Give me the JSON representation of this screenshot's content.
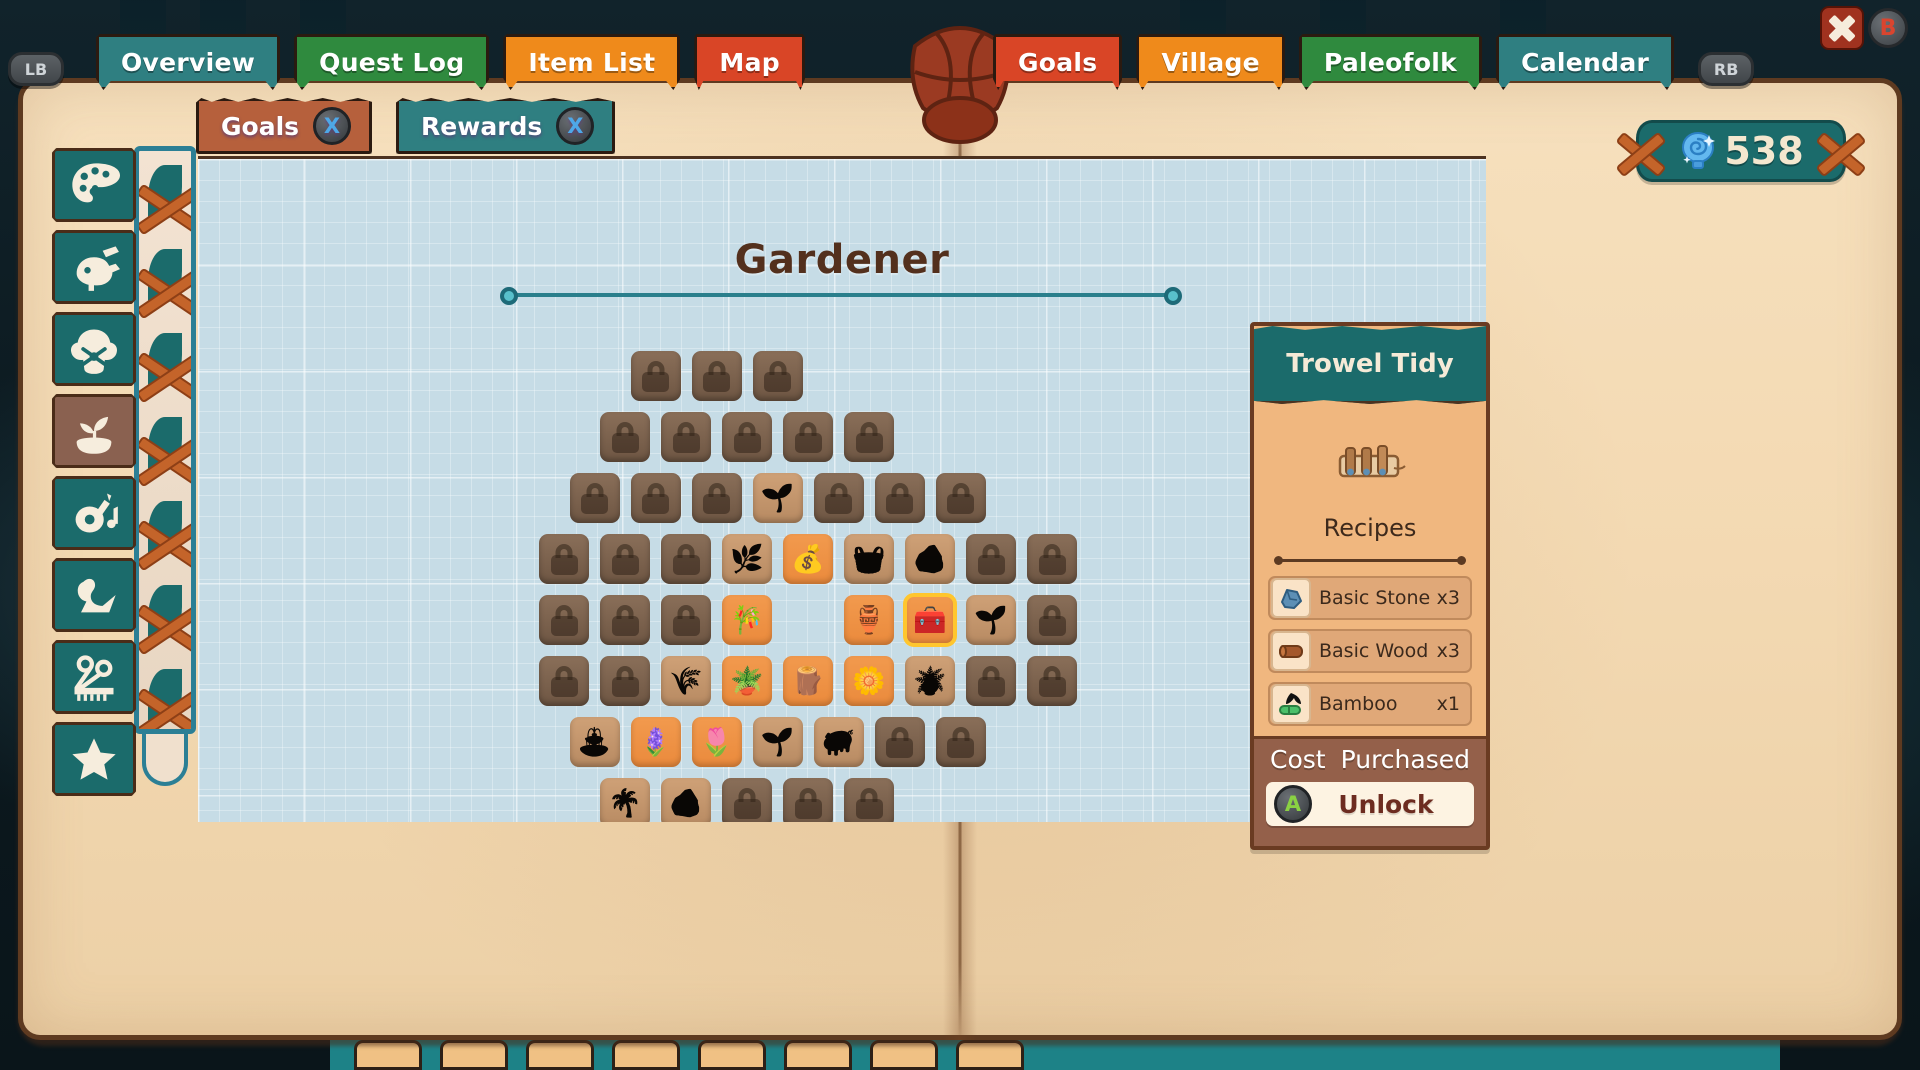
{
  "window": {
    "close_button": {
      "name": "close-button",
      "glyph": "X"
    },
    "close_hint": "B"
  },
  "top_tabs": {
    "left_bumper": "LB",
    "right_bumper": "RB",
    "items": [
      {
        "label": "Overview",
        "color": "#2f7f81",
        "active": false
      },
      {
        "label": "Quest Log",
        "color": "#2f8a3e",
        "active": false
      },
      {
        "label": "Item List",
        "color": "#ef8a1b",
        "active": false
      },
      {
        "label": "Map",
        "color": "#d94526",
        "active": false
      },
      {
        "label": "Goals",
        "color": "#d94526",
        "active": true
      },
      {
        "label": "Village",
        "color": "#ef8a1b",
        "active": false
      },
      {
        "label": "Paleofolk",
        "color": "#2f8a3e",
        "active": false
      },
      {
        "label": "Calendar",
        "color": "#2f7f81",
        "active": false
      }
    ]
  },
  "sub_tabs": [
    {
      "label": "Goals",
      "button": "X",
      "color": "#b6603c",
      "active": false
    },
    {
      "label": "Rewards",
      "button": "X",
      "color": "#2f7f81",
      "active": true
    }
  ],
  "currency": {
    "amount": "538",
    "icon": "shell-icon"
  },
  "sidebar": {
    "items": [
      {
        "name": "sidebar-item-art",
        "icon": "palette-icon",
        "active": false
      },
      {
        "name": "sidebar-item-fossils",
        "icon": "fossil-icon",
        "active": false
      },
      {
        "name": "sidebar-item-cooking",
        "icon": "cooking-icon",
        "active": false
      },
      {
        "name": "sidebar-item-gardener",
        "icon": "potted-plant-icon",
        "active": true
      },
      {
        "name": "sidebar-item-music",
        "icon": "guitar-icon",
        "active": false
      },
      {
        "name": "sidebar-item-origami",
        "icon": "origami-swan-icon",
        "active": false
      },
      {
        "name": "sidebar-item-barber",
        "icon": "scissors-comb-icon",
        "active": false
      },
      {
        "name": "sidebar-item-favorites",
        "icon": "star-icon",
        "active": false
      }
    ]
  },
  "page": {
    "title": "Gardener",
    "progress": {
      "start_node": true,
      "end_node": true
    }
  },
  "grid": {
    "rows": [
      {
        "offset": 5,
        "cells": [
          {
            "state": "locked",
            "icon": "lock-icon"
          },
          {
            "state": "locked",
            "icon": "lock-icon"
          },
          {
            "state": "locked",
            "icon": "lock-icon"
          }
        ]
      },
      {
        "offset": 4,
        "cells": [
          {
            "state": "locked",
            "icon": "lock-icon"
          },
          {
            "state": "locked",
            "icon": "lock-icon"
          },
          {
            "state": "locked",
            "icon": "lock-icon"
          },
          {
            "state": "locked",
            "icon": "lock-icon"
          },
          {
            "state": "locked",
            "icon": "lock-icon"
          }
        ]
      },
      {
        "offset": 3,
        "cells": [
          {
            "state": "locked",
            "icon": "lock-icon"
          },
          {
            "state": "locked",
            "icon": "lock-icon"
          },
          {
            "state": "locked",
            "icon": "lock-icon"
          },
          {
            "state": "unlocked",
            "icon": "sprout-bowl-icon",
            "glyph": "🌱"
          },
          {
            "state": "locked",
            "icon": "lock-icon"
          },
          {
            "state": "locked",
            "icon": "lock-icon"
          },
          {
            "state": "locked",
            "icon": "lock-icon"
          }
        ]
      },
      {
        "offset": 2,
        "cells": [
          {
            "state": "locked",
            "icon": "lock-icon"
          },
          {
            "state": "locked",
            "icon": "lock-icon"
          },
          {
            "state": "locked",
            "icon": "lock-icon"
          },
          {
            "state": "unlocked",
            "icon": "bush-icon",
            "glyph": "🌿"
          },
          {
            "state": "owned",
            "icon": "seed-bag-icon",
            "glyph": "💰"
          },
          {
            "state": "unlocked",
            "icon": "basket-icon",
            "glyph": "🧺"
          },
          {
            "state": "unlocked",
            "icon": "rock-garden-icon",
            "glyph": "🪨"
          },
          {
            "state": "locked",
            "icon": "lock-icon"
          },
          {
            "state": "locked",
            "icon": "lock-icon"
          }
        ]
      },
      {
        "offset": 2,
        "cells": [
          {
            "state": "locked",
            "icon": "lock-icon"
          },
          {
            "state": "locked",
            "icon": "lock-icon"
          },
          {
            "state": "locked",
            "icon": "lock-icon"
          },
          {
            "state": "owned",
            "icon": "rake-icon",
            "glyph": "🎋"
          },
          {
            "state": "empty",
            "icon": ""
          },
          {
            "state": "owned",
            "icon": "vase-icon",
            "glyph": "🏺"
          },
          {
            "state": "owned",
            "icon": "trowel-tidy-icon",
            "glyph": "🧰",
            "selected": true
          },
          {
            "state": "unlocked",
            "icon": "potted-sprout-icon",
            "glyph": "🌱"
          },
          {
            "state": "locked",
            "icon": "lock-icon"
          }
        ]
      },
      {
        "offset": 2,
        "cells": [
          {
            "state": "locked",
            "icon": "lock-icon"
          },
          {
            "state": "locked",
            "icon": "lock-icon"
          },
          {
            "state": "unlocked",
            "icon": "shrub-icon",
            "glyph": "🌾"
          },
          {
            "state": "owned",
            "icon": "planter-box-icon",
            "glyph": "🪴"
          },
          {
            "state": "owned",
            "icon": "log-icon",
            "glyph": "🪵"
          },
          {
            "state": "owned",
            "icon": "flower-trough-icon",
            "glyph": "🌼"
          },
          {
            "state": "unlocked",
            "icon": "palm-pot-icon",
            "glyph": "🪴"
          },
          {
            "state": "locked",
            "icon": "lock-icon"
          },
          {
            "state": "locked",
            "icon": "lock-icon"
          }
        ]
      },
      {
        "offset": 3,
        "cells": [
          {
            "state": "unlocked",
            "icon": "birdbath-icon",
            "glyph": "⛲"
          },
          {
            "state": "owned",
            "icon": "venus-flytrap-icon",
            "glyph": "🪻"
          },
          {
            "state": "owned",
            "icon": "flower-bed-icon",
            "glyph": "🌷"
          },
          {
            "state": "unlocked",
            "icon": "sprout-pot-icon",
            "glyph": "🌱"
          },
          {
            "state": "unlocked",
            "icon": "topiary-icon",
            "glyph": "🐖"
          },
          {
            "state": "locked",
            "icon": "lock-icon"
          },
          {
            "state": "locked",
            "icon": "lock-icon"
          }
        ]
      },
      {
        "offset": 4,
        "cells": [
          {
            "state": "unlocked",
            "icon": "sapling-icon",
            "glyph": "🌴"
          },
          {
            "state": "unlocked",
            "icon": "stone-pile-icon",
            "glyph": "🪨"
          },
          {
            "state": "locked",
            "icon": "lock-icon"
          },
          {
            "state": "locked",
            "icon": "lock-icon"
          },
          {
            "state": "locked",
            "icon": "lock-icon"
          }
        ]
      },
      {
        "offset": 5,
        "cells": [
          {
            "state": "locked",
            "icon": "lock-icon"
          },
          {
            "state": "empty",
            "icon": ""
          },
          {
            "state": "locked",
            "icon": "lock-icon"
          }
        ]
      }
    ]
  },
  "info_panel": {
    "title": "Trowel Tidy",
    "item_icon": "trowel-tidy-icon",
    "recipes_label": "Recipes",
    "ingredients": [
      {
        "name": "Basic Stone",
        "qty": "x3",
        "icon": "stone-icon"
      },
      {
        "name": "Basic Wood",
        "qty": "x3",
        "icon": "wood-log-icon"
      },
      {
        "name": "Bamboo",
        "qty": "x1",
        "icon": "bamboo-icon"
      }
    ],
    "cost_label": "Cost",
    "cost_value": "Purchased",
    "unlock_label": "Unlock",
    "unlock_button_glyph": "A"
  }
}
